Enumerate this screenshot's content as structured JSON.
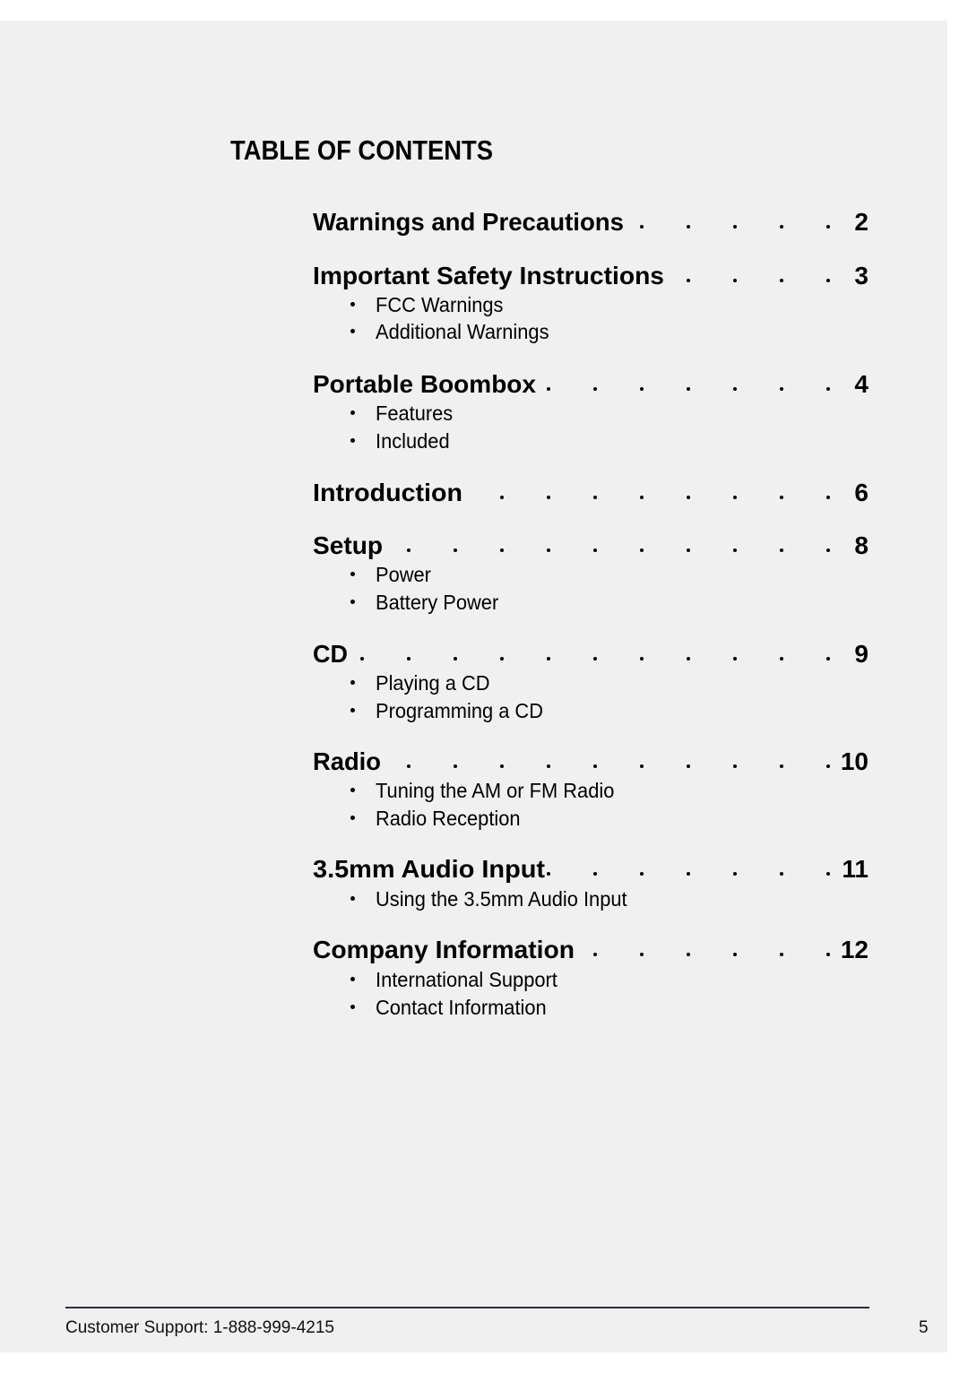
{
  "toc": {
    "title": "TABLE OF CONTENTS",
    "entries": [
      {
        "title": "Warnings and Precautions",
        "page": "2",
        "subitems": []
      },
      {
        "title": "Important Safety Instructions",
        "page": "3",
        "subitems": [
          "FCC Warnings",
          "Additional Warnings"
        ]
      },
      {
        "title": "Portable Boombox",
        "page": "4",
        "subitems": [
          "Features",
          "Included"
        ]
      },
      {
        "title": "Introduction",
        "page": "6",
        "subitems": []
      },
      {
        "title": "Setup",
        "page": "8",
        "subitems": [
          "Power",
          "Battery Power"
        ]
      },
      {
        "title": "CD",
        "page": "9",
        "subitems": [
          "Playing a CD",
          "Programming a CD"
        ]
      },
      {
        "title": "Radio",
        "page": "10",
        "subitems": [
          "Tuning the AM or FM Radio",
          "Radio Reception"
        ]
      },
      {
        "title": "3.5mm Audio Input",
        "page": "11",
        "subitems": [
          "Using the 3.5mm Audio Input"
        ]
      },
      {
        "title": "Company Information",
        "page": "12",
        "subitems": [
          "International Support",
          "Contact Information"
        ]
      }
    ]
  },
  "footer": {
    "support_text": "Customer Support: 1-888-999-4215",
    "page_number": "5"
  }
}
